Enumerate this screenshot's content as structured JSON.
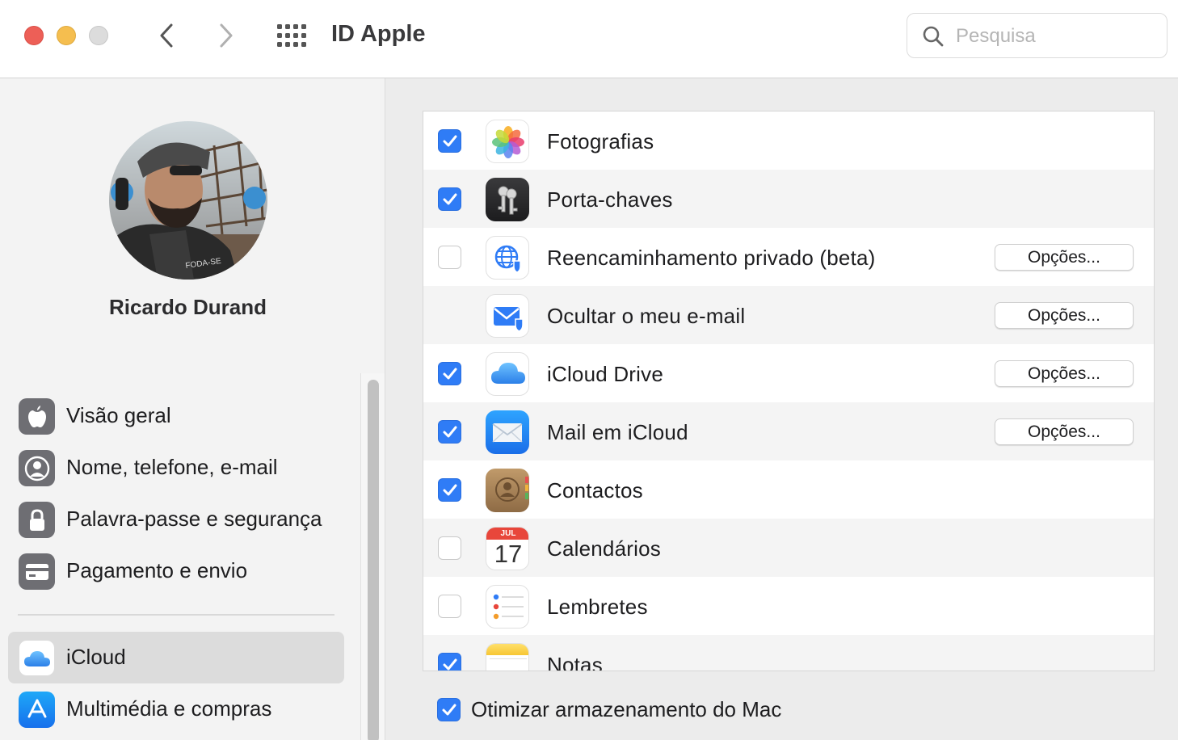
{
  "window": {
    "title": "ID Apple"
  },
  "search": {
    "placeholder": "Pesquisa"
  },
  "user": {
    "name": "Ricardo Durand"
  },
  "sidebar": {
    "items": [
      {
        "label": "Visão geral",
        "icon": "apple-logo-icon"
      },
      {
        "label": "Nome, telefone, e-mail",
        "icon": "person-icon"
      },
      {
        "label": "Palavra-passe e segurança",
        "icon": "lock-icon"
      },
      {
        "label": "Pagamento e envio",
        "icon": "credit-card-icon"
      },
      {
        "label": "iCloud",
        "icon": "icloud-icon",
        "selected": true
      },
      {
        "label": "Multimédia e compras",
        "icon": "app-store-icon"
      }
    ]
  },
  "apps": [
    {
      "label": "Fotografias",
      "checked": true,
      "icon": "photos-icon"
    },
    {
      "label": "Porta-chaves",
      "checked": true,
      "icon": "keychain-icon"
    },
    {
      "label": "Reencaminhamento privado (beta)",
      "checked": false,
      "icon": "private-relay-icon",
      "options": "Opções..."
    },
    {
      "label": "Ocultar o meu e-mail",
      "checked": null,
      "icon": "hide-my-email-icon",
      "options": "Opções..."
    },
    {
      "label": "iCloud Drive",
      "checked": true,
      "icon": "icloud-drive-icon",
      "options": "Opções..."
    },
    {
      "label": "Mail em iCloud",
      "checked": true,
      "icon": "mail-icon",
      "options": "Opções..."
    },
    {
      "label": "Contactos",
      "checked": true,
      "icon": "contacts-icon"
    },
    {
      "label": "Calendários",
      "checked": false,
      "icon": "calendar-icon",
      "calendar_month": "JUL",
      "calendar_day": "17"
    },
    {
      "label": "Lembretes",
      "checked": false,
      "icon": "reminders-icon"
    },
    {
      "label": "Notas",
      "checked": true,
      "icon": "notes-icon"
    }
  ],
  "optimize": {
    "label": "Otimizar armazenamento do Mac",
    "checked": true
  },
  "colors": {
    "accent": "#2f7cf6",
    "selected_bg": "#dcdcdc"
  }
}
